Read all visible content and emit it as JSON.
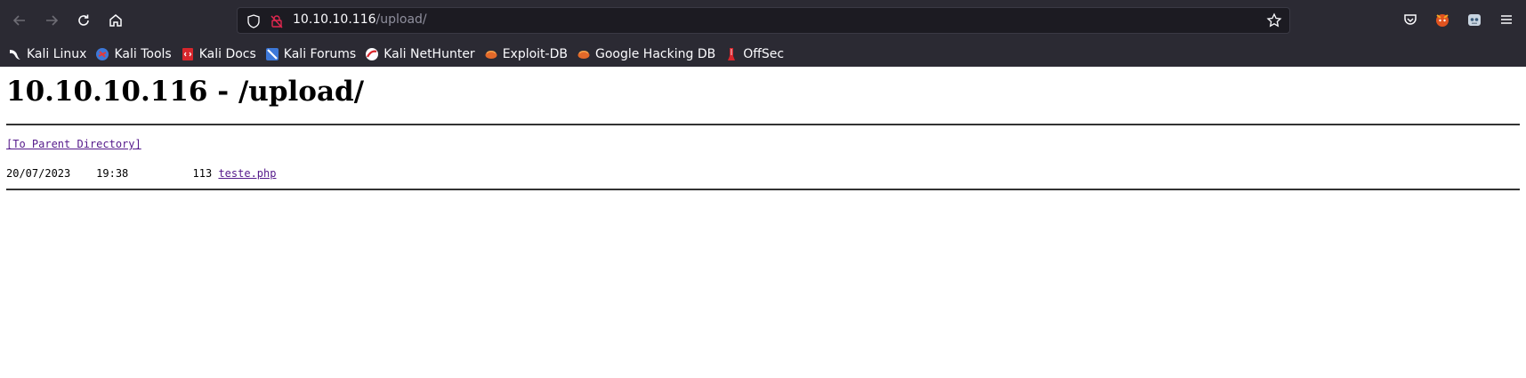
{
  "browser": {
    "url_host": "10.10.10.116",
    "url_path": "/upload/",
    "bookmarks": [
      {
        "label": "Kali Linux",
        "icon": "kali-dragon-icon"
      },
      {
        "label": "Kali Tools",
        "icon": "kali-tools-icon"
      },
      {
        "label": "Kali Docs",
        "icon": "kali-docs-icon"
      },
      {
        "label": "Kali Forums",
        "icon": "kali-forums-icon"
      },
      {
        "label": "Kali NetHunter",
        "icon": "nethunter-icon"
      },
      {
        "label": "Exploit-DB",
        "icon": "exploit-db-icon"
      },
      {
        "label": "Google Hacking DB",
        "icon": "ghdb-icon"
      },
      {
        "label": "OffSec",
        "icon": "offsec-icon"
      }
    ]
  },
  "page": {
    "title": "10.10.10.116 - /upload/",
    "parent_link": "[To Parent Directory]",
    "files": [
      {
        "date": "20/07/2023",
        "time": "19:38",
        "size": "113",
        "name": "teste.php"
      }
    ]
  }
}
